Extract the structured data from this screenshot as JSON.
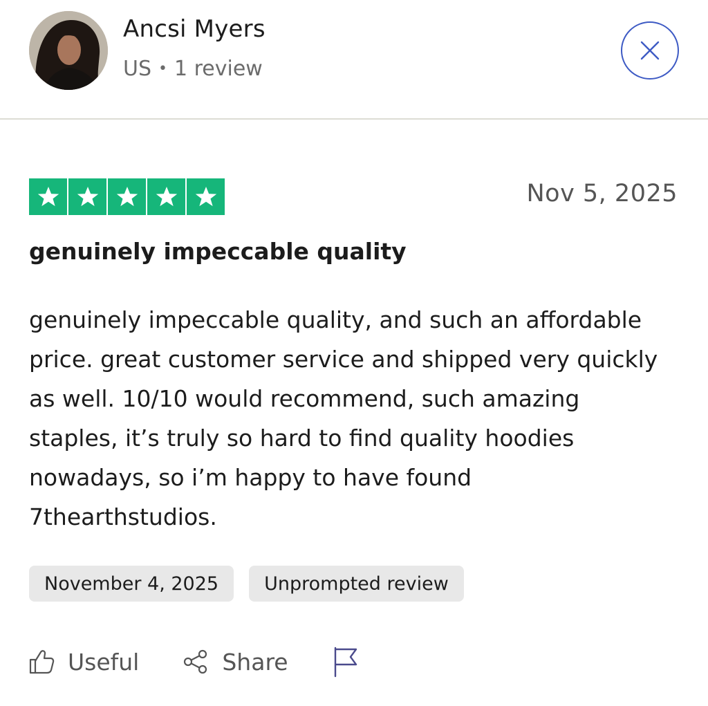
{
  "reviewer": {
    "name": "Ancsi Myers",
    "country": "US",
    "separator": "•",
    "review_count": "1 review"
  },
  "review": {
    "rating": 5,
    "date": "Nov 5, 2025",
    "title": "genuinely impeccable quality",
    "body": "genuinely impeccable quality, and such an affordable price. great customer service and shipped very quickly as well. 10/10 would recommend, such amazing staples, it’s truly so hard to find quality hoodies nowadays, so i’m happy to have found 7thearthstudios.",
    "tags": [
      "November 4, 2025",
      "Unprompted review"
    ]
  },
  "actions": {
    "useful_label": "Useful",
    "share_label": "Share"
  },
  "icons": {
    "close": "close-icon",
    "star": "star-icon",
    "thumbs_up": "thumbs-up-icon",
    "share": "share-icon",
    "flag": "flag-icon"
  },
  "colors": {
    "star_green": "#16b67a",
    "close_blue": "#3d5ac4",
    "tag_bg": "#e8e8e8",
    "muted_text": "#6b6b6b"
  }
}
